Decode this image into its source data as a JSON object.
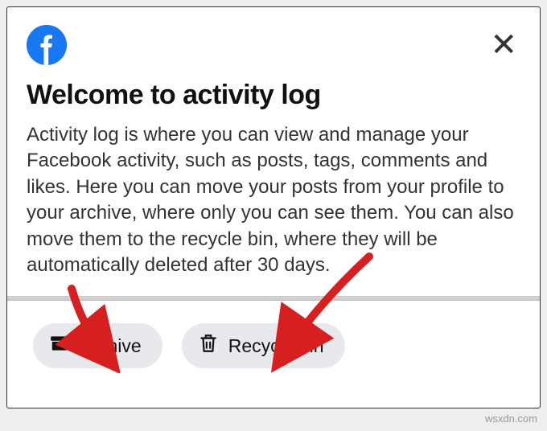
{
  "header": {
    "logo_name": "facebook-logo"
  },
  "title": "Welcome to activity log",
  "description": "Activity log is where you can view and manage your Facebook activity, such as posts, tags, comments and likes. Here you can move your posts from your profile to your archive, where only you can see them. You can also move them to the recycle bin, where they will be automatically deleted after 30 days.",
  "buttons": {
    "archive": "Archive",
    "recycle": "Recycle bin"
  },
  "watermark": "wsxdn.com"
}
